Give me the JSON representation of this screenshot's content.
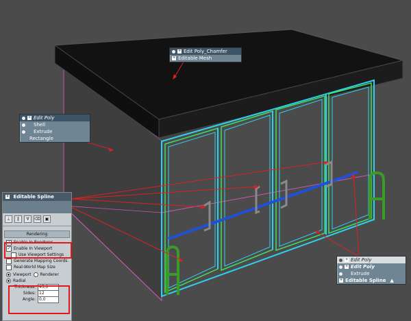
{
  "stack_top": {
    "items": [
      {
        "label": "Edit Poly_Chamfer",
        "style": "sel"
      },
      {
        "label": "Editable Mesh",
        "style": "normal"
      }
    ]
  },
  "stack_left": {
    "items": [
      {
        "label": "Edit Poly",
        "style": "sel-italic"
      },
      {
        "label": "Shell",
        "style": "normal"
      },
      {
        "label": "Extrude",
        "style": "normal"
      },
      {
        "label": "Rectangle",
        "style": "normal"
      }
    ]
  },
  "stack_right": {
    "items": [
      {
        "label": "Edit Poly",
        "style": "sel-italic"
      },
      {
        "label": "Edit Poly",
        "style": "bold-italic"
      },
      {
        "label": "Extrude",
        "style": "normal"
      },
      {
        "label": "Editable Spline",
        "style": "bold"
      }
    ]
  },
  "rollout": {
    "title": "Editable Spline",
    "section": "Rendering",
    "enable_renderer": "Enable In Renderer",
    "enable_viewport": "Enable In Viewport",
    "use_viewport": "Use Viewport Settings",
    "gen_mapping": "Generate Mapping Coords.",
    "real_world": "Real-World Map Size",
    "viewport_opt": "Viewport",
    "renderer_opt": "Renderer",
    "radial": "Radial",
    "thickness_label": "Thickness:",
    "thickness_value": "45,0",
    "sides_label": "Sides:",
    "sides_value": "12",
    "angle_label": "Angle:",
    "angle_value": "0,0"
  },
  "colors": {
    "frame_cyan": "#30d0f0",
    "frame_green": "#40e060",
    "bar_blue": "#2050d8",
    "handle_gray": "#8a8a8a",
    "rail_green": "#3a9a2a",
    "roof": "#121212",
    "arrow_red": "#e02020"
  }
}
